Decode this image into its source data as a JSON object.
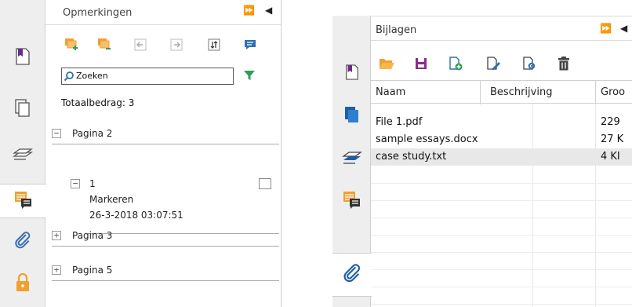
{
  "comments_panel": {
    "title": "Opmerkingen",
    "header_controls": {
      "expand": "⏩",
      "collapse": "◀"
    },
    "search": {
      "value": "Zoeken"
    },
    "total_label": "Totaalbedrag: 3",
    "pages": [
      {
        "label": "Pagina 2",
        "expanded": true,
        "toggle": "−"
      },
      {
        "label": "Pagina 3",
        "expanded": false,
        "toggle": "+"
      },
      {
        "label": "Pagina 5",
        "expanded": false,
        "toggle": "+"
      }
    ],
    "comment": {
      "toggle": "−",
      "number": "1",
      "type": "Markeren",
      "timestamp": "26-3-2018 03:07:51"
    },
    "toolbar_icons": [
      "expand-all-icon",
      "collapse-all-icon",
      "previous-icon",
      "next-icon",
      "sort-icon",
      "comment-icon"
    ],
    "side_tabs": [
      "page-icon",
      "pages-icon",
      "layers-icon",
      "comments-icon",
      "attachment-icon",
      "lock-icon"
    ]
  },
  "attachments_panel": {
    "title": "Bijlagen",
    "header_controls": {
      "expand": "⏩",
      "collapse": "◀"
    },
    "columns": [
      "Naam",
      "Beschrijving",
      "Groo"
    ],
    "rows": [
      {
        "name": "File 1.pdf",
        "description": "",
        "size": "229"
      },
      {
        "name": "sample essays.docx",
        "description": "",
        "size": "27 K"
      },
      {
        "name": "case study.txt",
        "description": "",
        "size": "4 KI"
      }
    ],
    "selected_row": 2,
    "toolbar_icons": [
      "open-folder-icon",
      "save-icon",
      "add-file-icon",
      "edit-file-icon",
      "file-settings-icon",
      "delete-icon"
    ],
    "side_tabs": [
      "page-icon",
      "pages-icon",
      "layers-icon",
      "comments-icon",
      "attachment-icon"
    ]
  },
  "colors": {
    "accent_orange": "#f0a030",
    "accent_purple": "#8a2b8a",
    "accent_green": "#2e9e57",
    "accent_blue": "#2f6fb0",
    "selected_row": "#e8e8e8"
  }
}
